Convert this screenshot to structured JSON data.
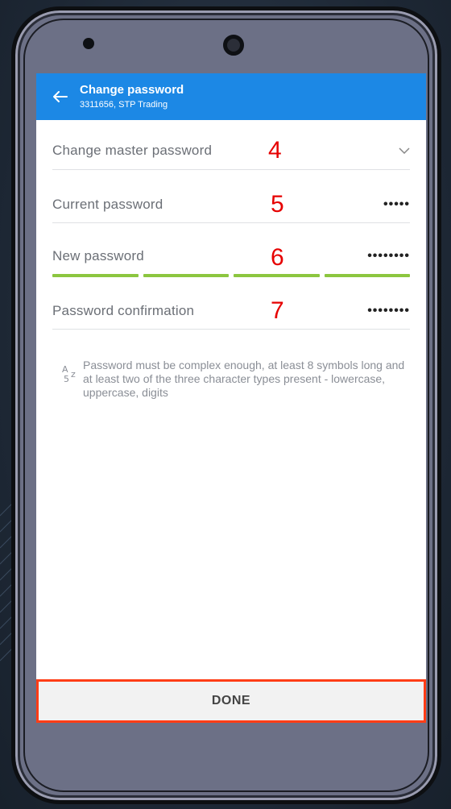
{
  "appbar": {
    "title": "Change password",
    "subtitle": "3311656, STP Trading"
  },
  "fields": {
    "master": {
      "label": "Change master password",
      "annotation": "4"
    },
    "current": {
      "label": "Current password",
      "value": "•••••",
      "annotation": "5"
    },
    "new": {
      "label": "New password",
      "value": "••••••••",
      "annotation": "6",
      "strength_level_segments": 4
    },
    "confirm": {
      "label": "Password confirmation",
      "value": "••••••••",
      "annotation": "7"
    }
  },
  "hint": {
    "icon": "az-icon",
    "text": "Password must be complex enough, at least 8 symbols long and at least two of the three character types present - lowercase, uppercase, digits"
  },
  "done": {
    "label": "DONE"
  },
  "colors": {
    "appbar": "#1c88e5",
    "strength": "#8cc63f",
    "highlight": "#ff3d16",
    "annotation": "#e60000"
  }
}
